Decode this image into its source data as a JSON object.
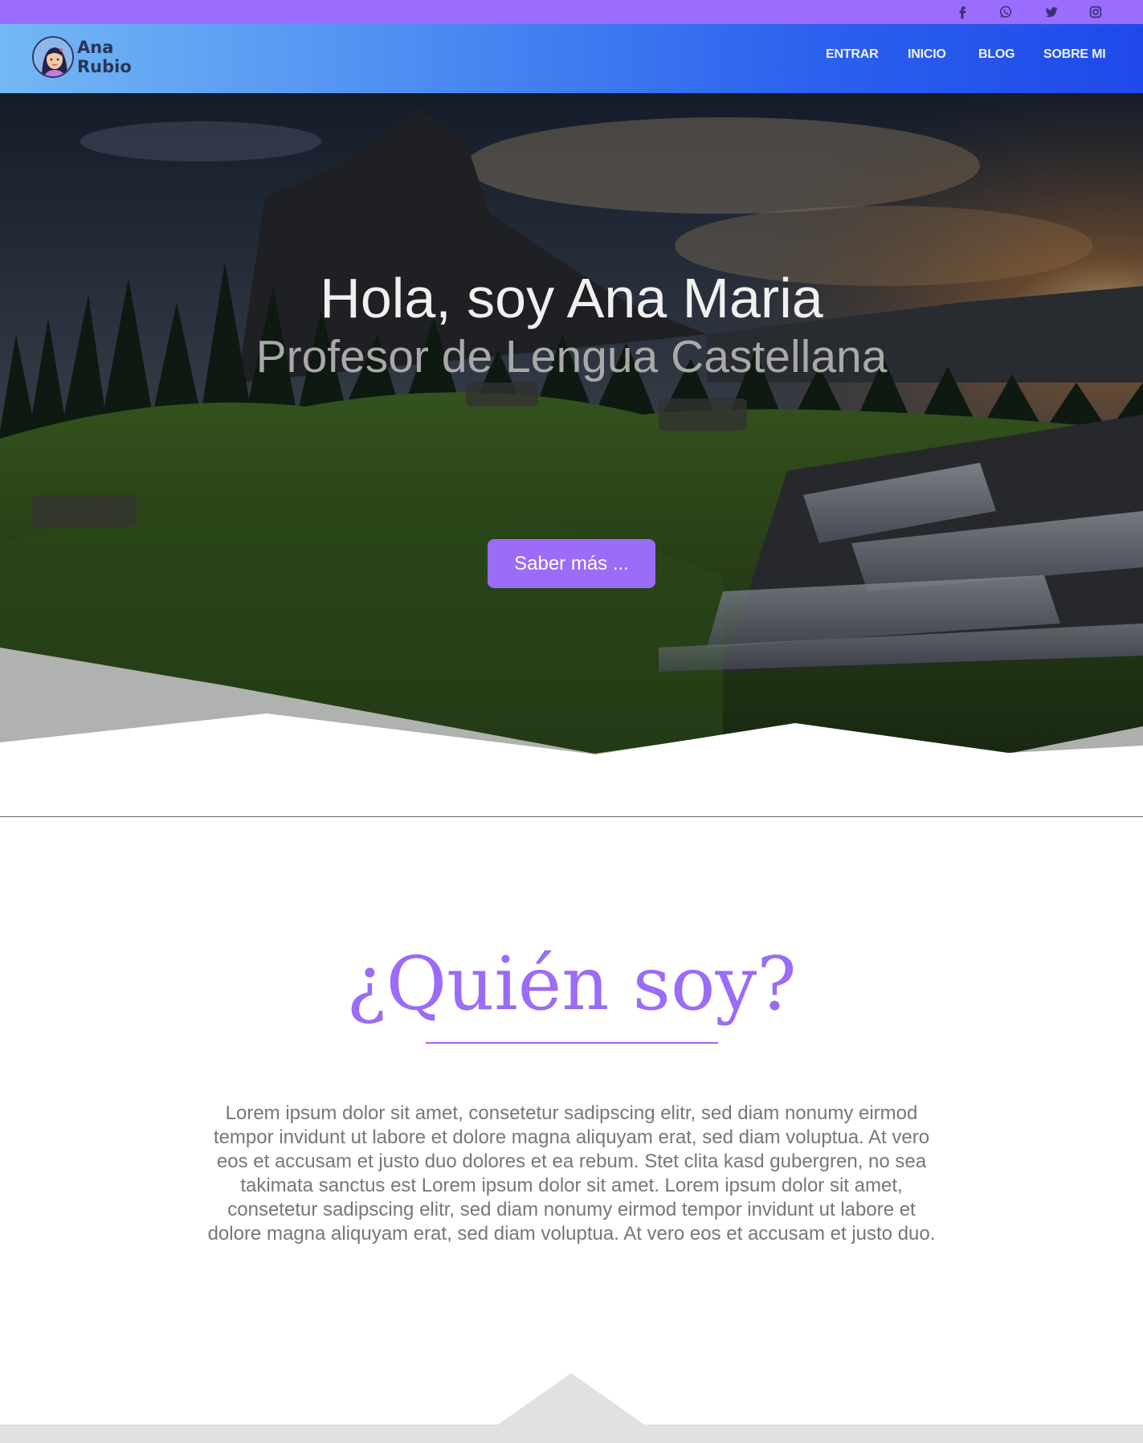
{
  "social": [
    {
      "icon": "facebook-icon"
    },
    {
      "icon": "whatsapp-icon"
    },
    {
      "icon": "twitter-icon"
    },
    {
      "icon": "instagram-icon"
    }
  ],
  "logo": {
    "line1": "Ana",
    "line2": "Rubio"
  },
  "nav": {
    "entrar": "ENTRAR",
    "inicio": "INICIO",
    "blog": "BLOG",
    "sobre_mi": "SOBRE MI"
  },
  "hero": {
    "title": "Hola, soy Ana Maria",
    "subtitle": "Profesor de Lengua Castellana",
    "button": "Saber más ..."
  },
  "about": {
    "title": "¿Quién soy?",
    "text": "Lorem ipsum dolor sit amet, consetetur sadipscing elitr, sed diam nonumy eirmod tempor invidunt ut labore et dolore magna aliquyam erat, sed diam voluptua. At vero eos et accusam et justo duo dolores et ea rebum. Stet clita kasd gubergren, no sea takimata sanctus est Lorem ipsum dolor sit amet. Lorem ipsum dolor sit amet, consetetur sadipscing elitr, sed diam nonumy eirmod tempor invidunt ut labore et dolore magna aliquyam erat, sed diam voluptua. At vero eos et accusam et justo duo."
  },
  "colors": {
    "topbar": "#9a6dff",
    "accent": "#9a6cf8",
    "nav_gradient_start": "#73b8f5",
    "nav_gradient_end": "#1f49ea",
    "underline": "#b060e0"
  }
}
